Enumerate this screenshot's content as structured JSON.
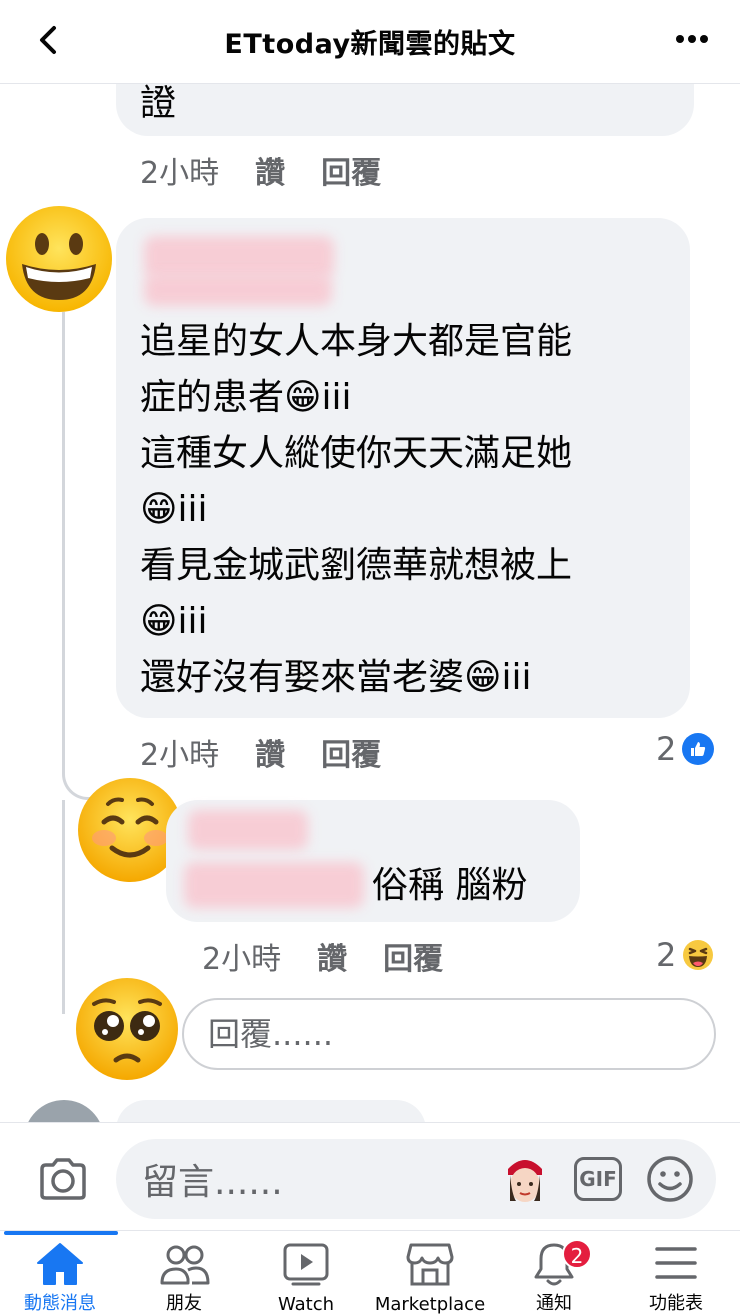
{
  "header": {
    "title": "ETtoday新聞雲的貼文"
  },
  "top_comment": {
    "text_tail": "證",
    "time": "2小時",
    "like_label": "讚",
    "reply_label": "回覆"
  },
  "main_comment": {
    "lines": [
      "追星的女人本身大都是官能",
      "症的患者😁iii",
      "這種女人縱使你天天滿足她",
      "😁iii",
      "看見金城武劉德華就想被上",
      "😁iii",
      "還好沒有娶來當老婆😁iii"
    ],
    "time": "2小時",
    "like_label": "讚",
    "reply_label": "回覆",
    "reaction_count": "2",
    "reaction_icon": "like-icon",
    "reaction_color": "#1877f2"
  },
  "reply_comment": {
    "text": "俗稱 腦粉",
    "time": "2小時",
    "like_label": "讚",
    "reply_label": "回覆",
    "reaction_count": "2",
    "reaction_icon": "haha-icon"
  },
  "reply_input": {
    "placeholder": "回覆......"
  },
  "composer": {
    "placeholder": "留言......",
    "gif_label": "GIF"
  },
  "tabs": [
    {
      "label": "動態消息",
      "icon": "home-icon",
      "active": true
    },
    {
      "label": "朋友",
      "icon": "friends-icon"
    },
    {
      "label": "Watch",
      "icon": "watch-icon"
    },
    {
      "label": "Marketplace",
      "icon": "marketplace-icon"
    },
    {
      "label": "通知",
      "icon": "bell-icon",
      "badge": "2"
    },
    {
      "label": "功能表",
      "icon": "menu-icon"
    }
  ],
  "colors": {
    "accent": "#1877f2",
    "bubble": "#f0f2f5",
    "badge": "#e41e3f"
  }
}
